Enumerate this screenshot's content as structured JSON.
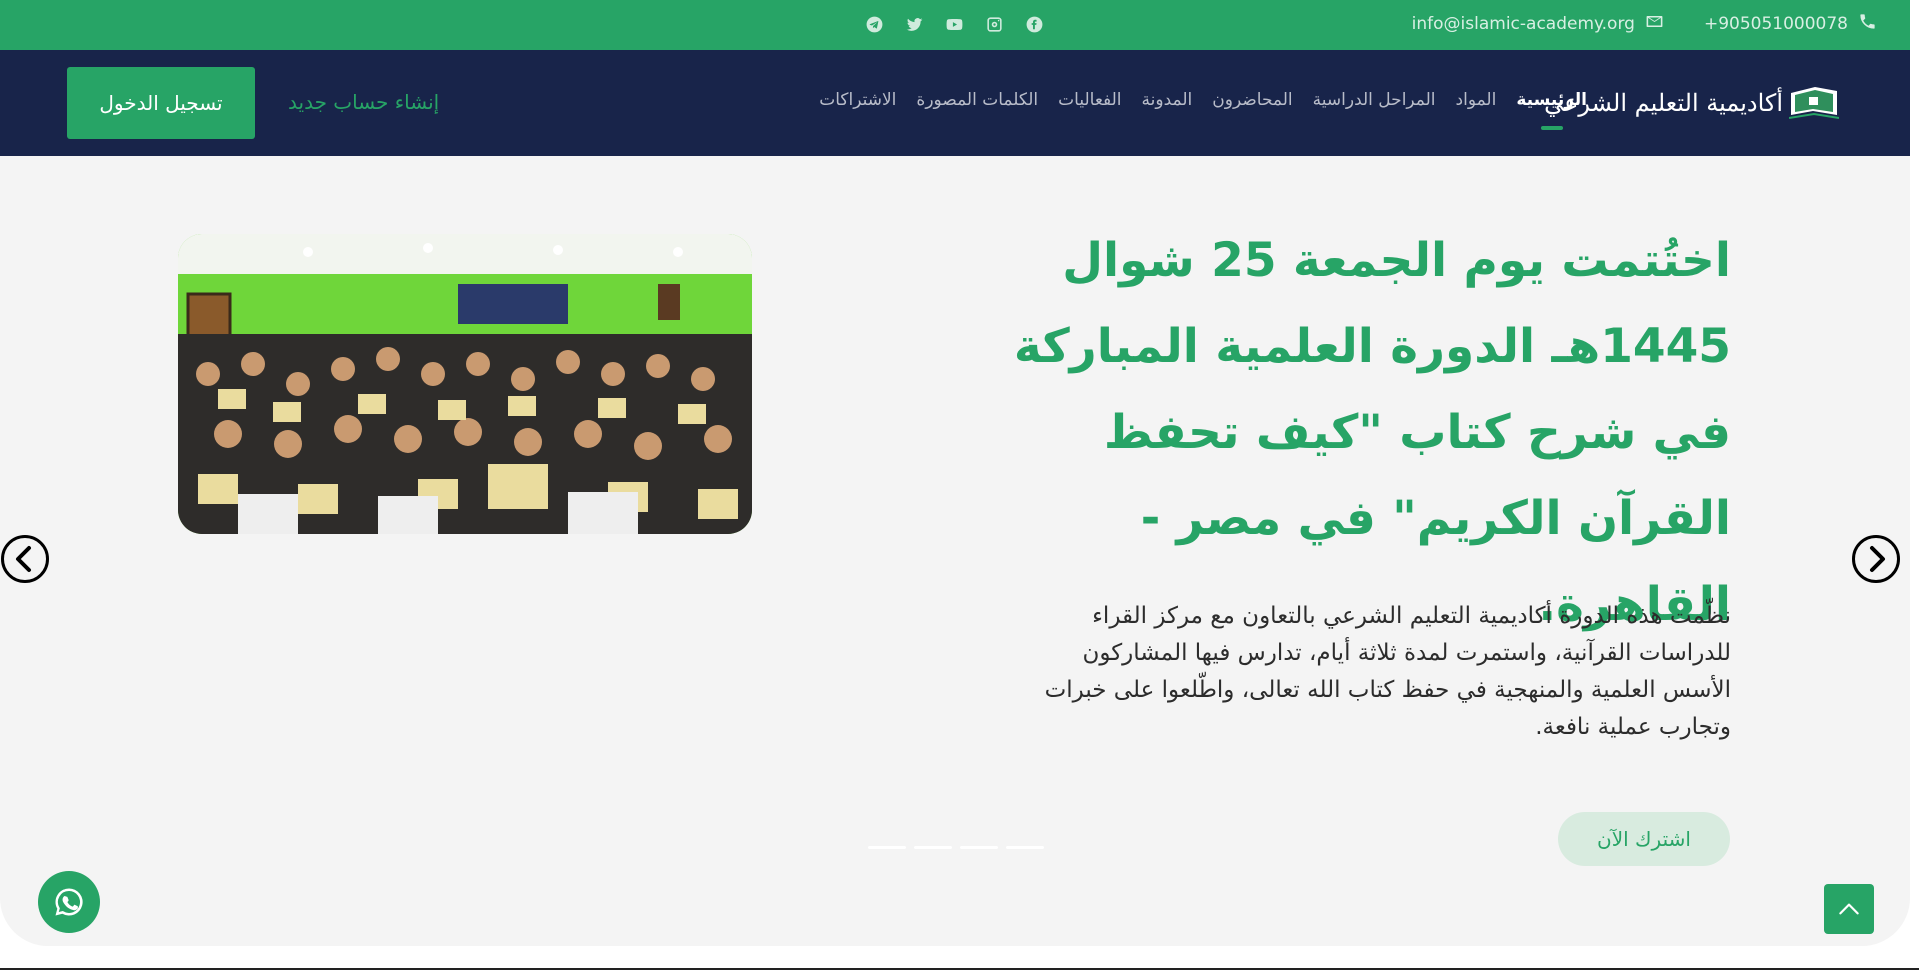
{
  "topbar": {
    "phone": "+905051000078",
    "email": "info@islamic-academy.org",
    "social_icons": [
      "facebook-icon",
      "instagram-icon",
      "youtube-icon",
      "twitter-icon",
      "telegram-icon"
    ]
  },
  "nav": {
    "logo_text": "أكاديمية التعليم الشرعي",
    "menu": [
      {
        "label": "الرئيسية",
        "active": true
      },
      {
        "label": "المواد"
      },
      {
        "label": "المراحل الدراسية"
      },
      {
        "label": "المحاضرون"
      },
      {
        "label": "المدونة"
      },
      {
        "label": "الفعاليات"
      },
      {
        "label": "الكلمات المصورة"
      },
      {
        "label": "الاشتراكات"
      }
    ],
    "register_label": "إنشاء حساب جديد",
    "login_label": "تسجيل الدخول"
  },
  "hero": {
    "title": "اختُتمت يوم الجمعة 25 شوال 1445هـ الدورة العلمية المباركة في شرح كتاب \"كيف تحفظ القرآن الكريم\" في مصر - القاهرة.",
    "description": "نظّمت هذه الدورة أكاديمية التعليم الشرعي بالتعاون مع مركز القراء للدراسات القرآنية، واستمرت لمدة ثلاثة أيام، تدارس فيها المشاركون الأسس العلمية والمنهجية في حفظ كتاب الله تعالى، واطّلعوا على خبرات وتجارب عملية نافعة.",
    "cta_label": "اشترك الآن",
    "slide_count": 4
  },
  "colors": {
    "brand_green": "#27a466",
    "nav_navy": "#18244a",
    "hero_bg": "#f4f4f4"
  }
}
